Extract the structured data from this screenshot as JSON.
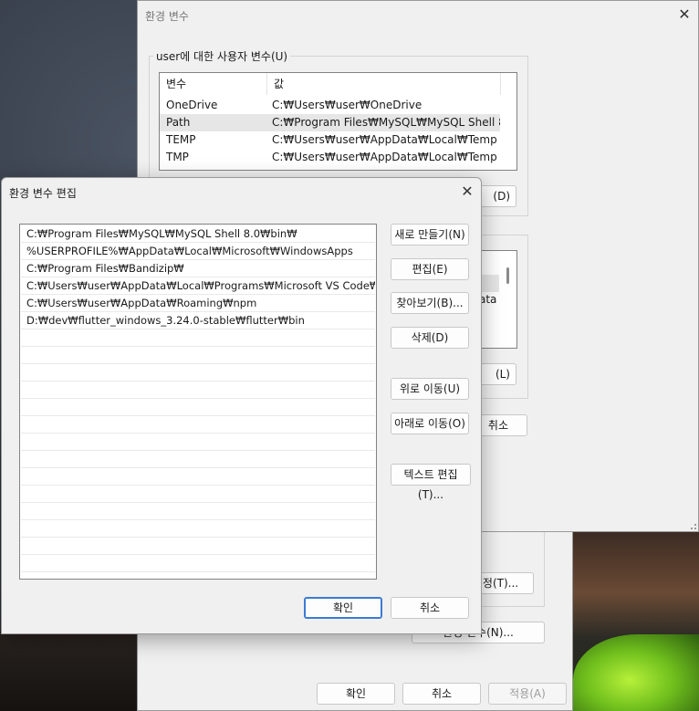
{
  "back_window": {
    "title": "환경 변수",
    "user_group_label": "user에 대한 사용자 변수(U)",
    "columns": [
      "변수",
      "값"
    ],
    "user_vars": [
      {
        "name": "OneDrive",
        "value": "C:₩Users₩user₩OneDrive"
      },
      {
        "name": "Path",
        "value": "C:₩Program Files₩MySQL₩MySQL Shell 8...."
      },
      {
        "name": "TEMP",
        "value": "C:₩Users₩user₩AppData₩Local₩Temp"
      },
      {
        "name": "TMP",
        "value": "C:₩Users₩user₩AppData₩Local₩Temp"
      }
    ],
    "partial_btn_delete": "(D)",
    "partial_sys_text": "ata",
    "partial_btn_l": "(L)",
    "partial_cancel": "취소",
    "ok": "확인",
    "cancel": "취소",
    "apply": "적용(A)"
  },
  "mid_window": {
    "partial_settings": "설정(T)...",
    "partial_envvar": "환경 변수(N)..."
  },
  "edit_dialog": {
    "title": "환경 변수 편집",
    "paths": [
      "C:₩Program Files₩MySQL₩MySQL Shell 8.0₩bin₩",
      "%USERPROFILE%₩AppData₩Local₩Microsoft₩WindowsApps",
      "C:₩Program Files₩Bandizip₩",
      "C:₩Users₩user₩AppData₩Local₩Programs₩Microsoft VS Code₩bin",
      "C:₩Users₩user₩AppData₩Roaming₩npm",
      "D:₩dev₩flutter_windows_3.24.0-stable₩flutter₩bin"
    ],
    "buttons": {
      "new": "새로 만들기(N)",
      "edit": "편집(E)",
      "browse": "찾아보기(B)...",
      "delete": "삭제(D)",
      "move_up": "위로 이동(U)",
      "move_down": "아래로 이동(O)",
      "edit_text": "텍스트 편집(T)..."
    },
    "ok": "확인",
    "cancel": "취소"
  }
}
